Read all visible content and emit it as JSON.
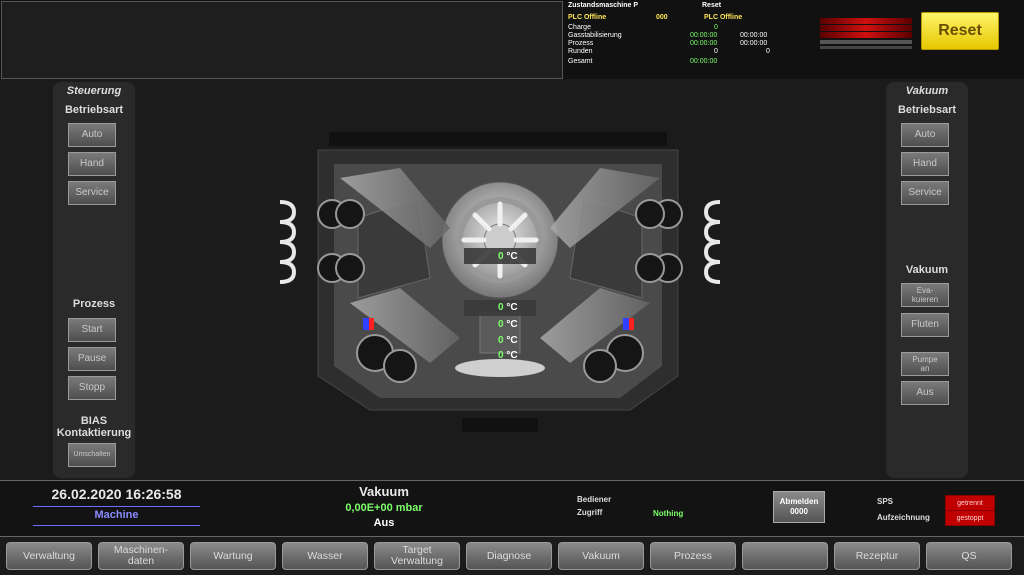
{
  "top": {
    "state_title": "Zustandsmaschine P",
    "reset_title": "Reset",
    "plc_left": "PLC Offline",
    "plc_left_val": "000",
    "plc_right": "PLC Offline",
    "rows": [
      {
        "label": "Charge",
        "a": "0",
        "b": ""
      },
      {
        "label": "Gasstabilisierung",
        "a": "00:00:00",
        "b": "00:00:00"
      },
      {
        "label": "Prozess",
        "a": "00:00:00",
        "b": "00:00:00"
      },
      {
        "label": "Runden",
        "a": "0",
        "b": "0"
      },
      {
        "label": "Gesamt",
        "a": "00:00:00",
        "b": ""
      }
    ],
    "reset_button": "Reset"
  },
  "steuerung": {
    "title": "Steuerung",
    "betriebsart": "Betriebsart",
    "buttons": [
      "Auto",
      "Hand",
      "Service"
    ],
    "prozess": "Prozess",
    "prozess_buttons": [
      "Start",
      "Pause",
      "Stopp"
    ],
    "bias": "BIAS",
    "kontaktierung": "Kontaktierung",
    "umschalten": "Umschalten"
  },
  "vakuum_panel": {
    "title": "Vakuum",
    "betriebsart": "Betriebsart",
    "buttons": [
      "Auto",
      "Hand",
      "Service"
    ],
    "vakuum": "Vakuum",
    "evak1": "Eva-",
    "evak2": "kuieren",
    "fluten": "Fluten",
    "pumpe1": "Pumpe",
    "pumpe2": "an",
    "aus": "Aus"
  },
  "temps": {
    "unit": "°C",
    "values": [
      "0",
      "0",
      "0",
      "0",
      "0"
    ]
  },
  "status": {
    "datetime": "26.02.2020 16:26:58",
    "machine": "Machine",
    "vakuum_title": "Vakuum",
    "pressure": "0,00E+00 mbar",
    "vakuum_state": "Aus",
    "bediener": "Bediener",
    "zugriff": "Zugriff",
    "zugriff_val": "Nothing",
    "abmelden": "Abmelden",
    "abmelden_code": "0000",
    "sps": "SPS",
    "sps_val": "getrennt",
    "aufzeichnung": "Aufzeichnung",
    "aufzeichnung_val": "gestoppt"
  },
  "nav": [
    "Verwaltung",
    "Maschinen-\ndaten",
    "Wartung",
    "Wasser",
    "Target\nVerwaltung",
    "Diagnose",
    "Vakuum",
    "Prozess",
    "",
    "Rezeptur",
    "QS"
  ],
  "colors": {
    "reset": "#ffe000",
    "green": "#7dff6a",
    "yellow": "#ffe65a",
    "alarm": "#c00000"
  }
}
